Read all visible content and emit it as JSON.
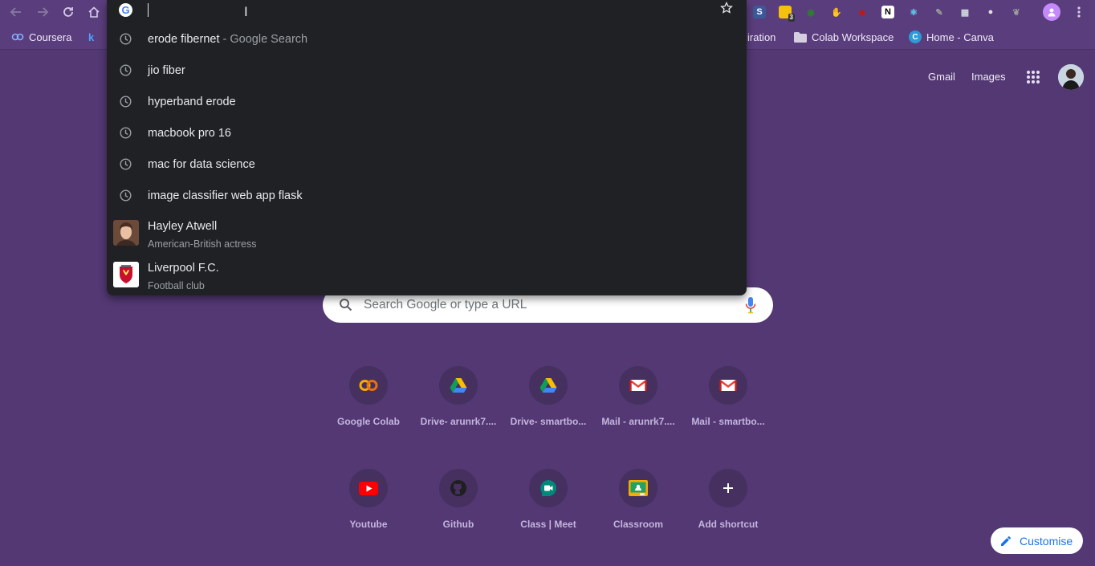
{
  "omnibox": {
    "input_value": "",
    "suggestions": [
      {
        "text": "erode fibernet",
        "hint": " - Google Search"
      },
      {
        "text": "jio fiber",
        "hint": ""
      },
      {
        "text": "hyperband erode",
        "hint": ""
      },
      {
        "text": "macbook pro 16",
        "hint": ""
      },
      {
        "text": "mac for data science",
        "hint": ""
      },
      {
        "text": "image classifier web app flask",
        "hint": ""
      }
    ],
    "entities": [
      {
        "title": "Hayley Atwell",
        "subtitle": "American-British actress",
        "icon": "person-thumbnail"
      },
      {
        "title": "Liverpool F.C.",
        "subtitle": "Football club",
        "icon": "liverpool-crest"
      }
    ]
  },
  "toolbar": {
    "extensions": [
      {
        "icon": "s-extension-icon",
        "color": "#3b5998",
        "glyph": "S"
      },
      {
        "icon": "sticky-note-extension-icon",
        "color": "#f4c20d",
        "glyph": "",
        "badge": "3"
      },
      {
        "icon": "owl-extension-icon",
        "color": "#2e7d32",
        "glyph": "◉"
      },
      {
        "icon": "adblock-extension-icon",
        "color": "#e53935",
        "glyph": "✋"
      },
      {
        "icon": "ublock-extension-icon",
        "color": "#b71c1c",
        "glyph": "◆"
      },
      {
        "icon": "notion-extension-icon",
        "color": "#ffffff",
        "glyph": "N"
      },
      {
        "icon": "react-devtools-icon",
        "color": "#61dafb",
        "glyph": "⚛"
      },
      {
        "icon": "pen-extension-icon",
        "color": "#9e9e9e",
        "glyph": "✎"
      },
      {
        "icon": "grid-extension-icon",
        "color": "#cfd8dc",
        "glyph": "▦"
      },
      {
        "icon": "circle-extension-icon",
        "color": "#e0e0e0",
        "glyph": "●"
      },
      {
        "icon": "leaf-extension-icon",
        "color": "#9e9e9e",
        "glyph": "❦"
      }
    ]
  },
  "bookmarks": {
    "coursera": "Coursera",
    "k_item": "k",
    "inspiration": "iration",
    "colab": "Colab Workspace",
    "canva": "Home - Canva"
  },
  "ntp": {
    "gmail": "Gmail",
    "images": "Images",
    "search_placeholder": "Search Google or type a URL",
    "shortcuts": [
      {
        "label": "Google Colab",
        "icon": "colab-icon"
      },
      {
        "label": "Drive- arunrk7....",
        "icon": "drive-icon"
      },
      {
        "label": "Drive- smartbo...",
        "icon": "drive-icon"
      },
      {
        "label": "Mail - arunrk7....",
        "icon": "gmail-icon"
      },
      {
        "label": "Mail - smartbo...",
        "icon": "gmail-icon"
      },
      {
        "label": "Youtube",
        "icon": "youtube-icon"
      },
      {
        "label": "Github",
        "icon": "github-icon"
      },
      {
        "label": "Class | Meet",
        "icon": "meet-icon"
      },
      {
        "label": "Classroom",
        "icon": "classroom-icon"
      },
      {
        "label": "Add shortcut",
        "icon": "plus-icon"
      }
    ],
    "customise": "Customise"
  },
  "colors": {
    "background": "#533874",
    "omnibox_bg": "#202124",
    "accent_blue": "#1a73e8"
  }
}
